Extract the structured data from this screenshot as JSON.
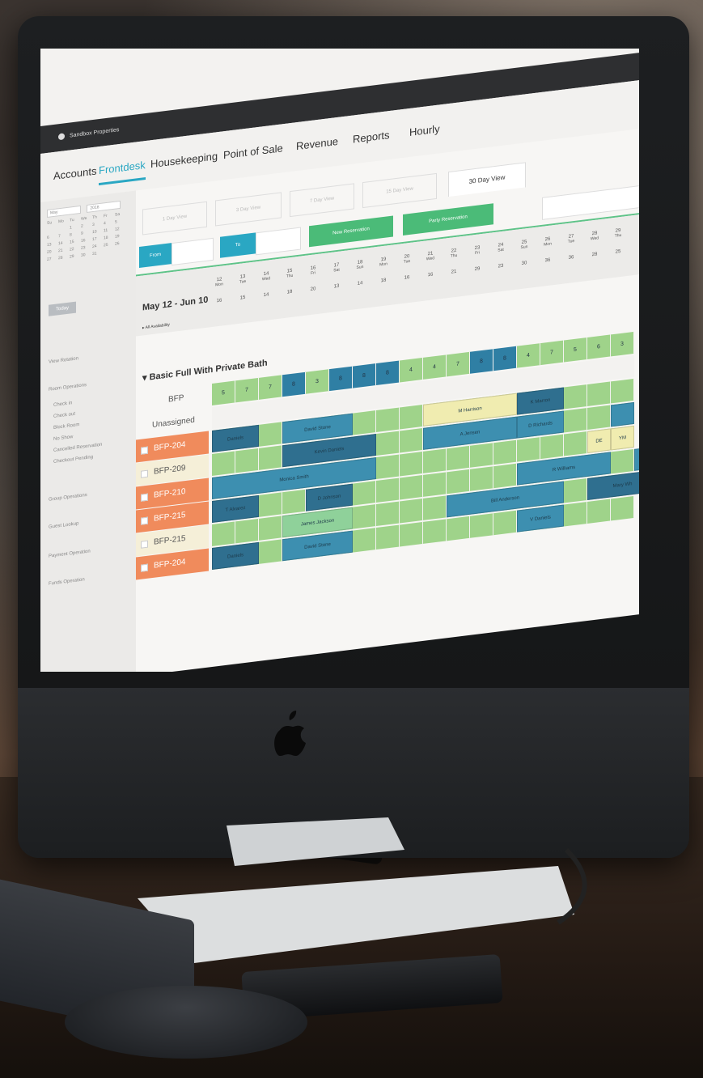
{
  "app": {
    "brand": "Sandbox Properties"
  },
  "nav": {
    "items": [
      "Accounts",
      "Frontdesk",
      "Housekeeping",
      "Point of Sale",
      "Revenue",
      "Reports",
      "Hourly"
    ],
    "active": "Frontdesk"
  },
  "sidebar": {
    "month": "May",
    "year": "2018",
    "weekday_headers": [
      "Su",
      "Mo",
      "Tu",
      "We",
      "Th",
      "Fr",
      "Sa"
    ],
    "goto_label": "Today",
    "items": [
      "View Rotation",
      "Room Operations",
      "Check in",
      "Check out",
      "Block Room",
      "No Show",
      "Cancelled Reservation",
      "Checkout Pending",
      "Group Operations",
      "Guest Lookup",
      "Payment Operation",
      "Funds Operation"
    ]
  },
  "view_tabs": [
    "1 Day View",
    "3 Day View",
    "7 Day View",
    "15 Day View",
    "30 Day View"
  ],
  "active_view": "30 Day View",
  "controls": {
    "from_label": "From",
    "to_label": "To",
    "new_reservation": "New Reservation",
    "party_reservation": "Party Reservation"
  },
  "date_range": "May 12 - Jun 10",
  "availability_label": "All Availability",
  "days": [
    {
      "d": "12",
      "w": "Mon",
      "a": "16"
    },
    {
      "d": "13",
      "w": "Tue",
      "a": "15"
    },
    {
      "d": "14",
      "w": "Wed",
      "a": "14"
    },
    {
      "d": "15",
      "w": "Thu",
      "a": "18"
    },
    {
      "d": "16",
      "w": "Fri",
      "a": "20"
    },
    {
      "d": "17",
      "w": "Sat",
      "a": "13"
    },
    {
      "d": "18",
      "w": "Sun",
      "a": "14"
    },
    {
      "d": "19",
      "w": "Mon",
      "a": "18"
    },
    {
      "d": "20",
      "w": "Tue",
      "a": "16"
    },
    {
      "d": "21",
      "w": "Wed",
      "a": "16"
    },
    {
      "d": "22",
      "w": "Thu",
      "a": "21"
    },
    {
      "d": "23",
      "w": "Fri",
      "a": "29"
    },
    {
      "d": "24",
      "w": "Sat",
      "a": "23"
    },
    {
      "d": "25",
      "w": "Sun",
      "a": "30"
    },
    {
      "d": "26",
      "w": "Mon",
      "a": "36"
    },
    {
      "d": "27",
      "w": "Tue",
      "a": "36"
    },
    {
      "d": "28",
      "w": "Wed",
      "a": "28"
    },
    {
      "d": "29",
      "w": "Thu",
      "a": "25"
    }
  ],
  "room_type": "Basic Full With Private Bath",
  "bfp_row": {
    "label": "BFP",
    "values": [
      "5",
      "7",
      "7",
      "8",
      "3",
      "8",
      "8",
      "8",
      "4",
      "4",
      "7",
      "8",
      "8",
      "4",
      "7",
      "5",
      "6",
      "3"
    ]
  },
  "unassigned_row": {
    "label": "Unassigned"
  },
  "rooms": [
    {
      "label": "BFP-204",
      "style": "orange"
    },
    {
      "label": "BFP-209",
      "style": "cream"
    },
    {
      "label": "BFP-210",
      "style": "orange"
    },
    {
      "label": "BFP-215",
      "style": "orange"
    },
    {
      "label": "BFP-215",
      "style": "cream"
    },
    {
      "label": "BFP-204",
      "style": "orange"
    }
  ],
  "bookings": [
    {
      "row": 0,
      "start": 0,
      "len": 2,
      "name": "Daniels",
      "color": "#2f6f8f"
    },
    {
      "row": 0,
      "start": 3,
      "len": 3,
      "name": "David Stone",
      "color": "#3d8fb0"
    },
    {
      "row": 0,
      "start": 9,
      "len": 4,
      "name": "M Harrison",
      "color": "#f0ecb0"
    },
    {
      "row": 0,
      "start": 13,
      "len": 2,
      "name": "K Marron",
      "color": "#2f6f8f"
    },
    {
      "row": 1,
      "start": 3,
      "len": 4,
      "name": "Kevin Daniels",
      "color": "#2f6f8f"
    },
    {
      "row": 1,
      "start": 9,
      "len": 4,
      "name": "A Jensen",
      "color": "#3d8fb0"
    },
    {
      "row": 1,
      "start": 13,
      "len": 2,
      "name": "D Richards",
      "color": "#3d8fb0"
    },
    {
      "row": 1,
      "start": 17,
      "len": 1,
      "name": "",
      "color": "#3d8fb0"
    },
    {
      "row": 2,
      "start": 0,
      "len": 7,
      "name": "Monica Smith",
      "color": "#3d8fb0"
    },
    {
      "row": 2,
      "start": 16,
      "len": 1,
      "name": "DE",
      "color": "#f0ecb0"
    },
    {
      "row": 2,
      "start": 17,
      "len": 1,
      "name": "YM",
      "color": "#f0ecb0"
    },
    {
      "row": 3,
      "start": 0,
      "len": 2,
      "name": "T Alvarez",
      "color": "#2f6f8f"
    },
    {
      "row": 3,
      "start": 4,
      "len": 2,
      "name": "D Johnson",
      "color": "#2f6f8f"
    },
    {
      "row": 3,
      "start": 13,
      "len": 4,
      "name": "R Williams",
      "color": "#3d8fb0"
    },
    {
      "row": 3,
      "start": 18,
      "len": 1,
      "name": "Jim",
      "color": "#3d8fb0"
    },
    {
      "row": 4,
      "start": 3,
      "len": 3,
      "name": "James Jackson",
      "color": "#8fd19a"
    },
    {
      "row": 4,
      "start": 10,
      "len": 5,
      "name": "Bill Anderson",
      "color": "#3d8fb0"
    },
    {
      "row": 4,
      "start": 16,
      "len": 3,
      "name": "Mary Wh",
      "color": "#2f6f8f"
    },
    {
      "row": 5,
      "start": 0,
      "len": 2,
      "name": "Daniels",
      "color": "#2f6f8f"
    },
    {
      "row": 5,
      "start": 3,
      "len": 3,
      "name": "David Stone",
      "color": "#3d8fb0"
    },
    {
      "row": 5,
      "start": 13,
      "len": 2,
      "name": "V Daniels",
      "color": "#3d8fb0"
    }
  ],
  "colors": {
    "accent": "#2aa7c3",
    "green_button": "#4bbb78",
    "blue_button": "#2aa7c3",
    "cell_green": "#9fd38a",
    "cell_blue": "#2f7fa4",
    "orange": "#f08b5c"
  }
}
